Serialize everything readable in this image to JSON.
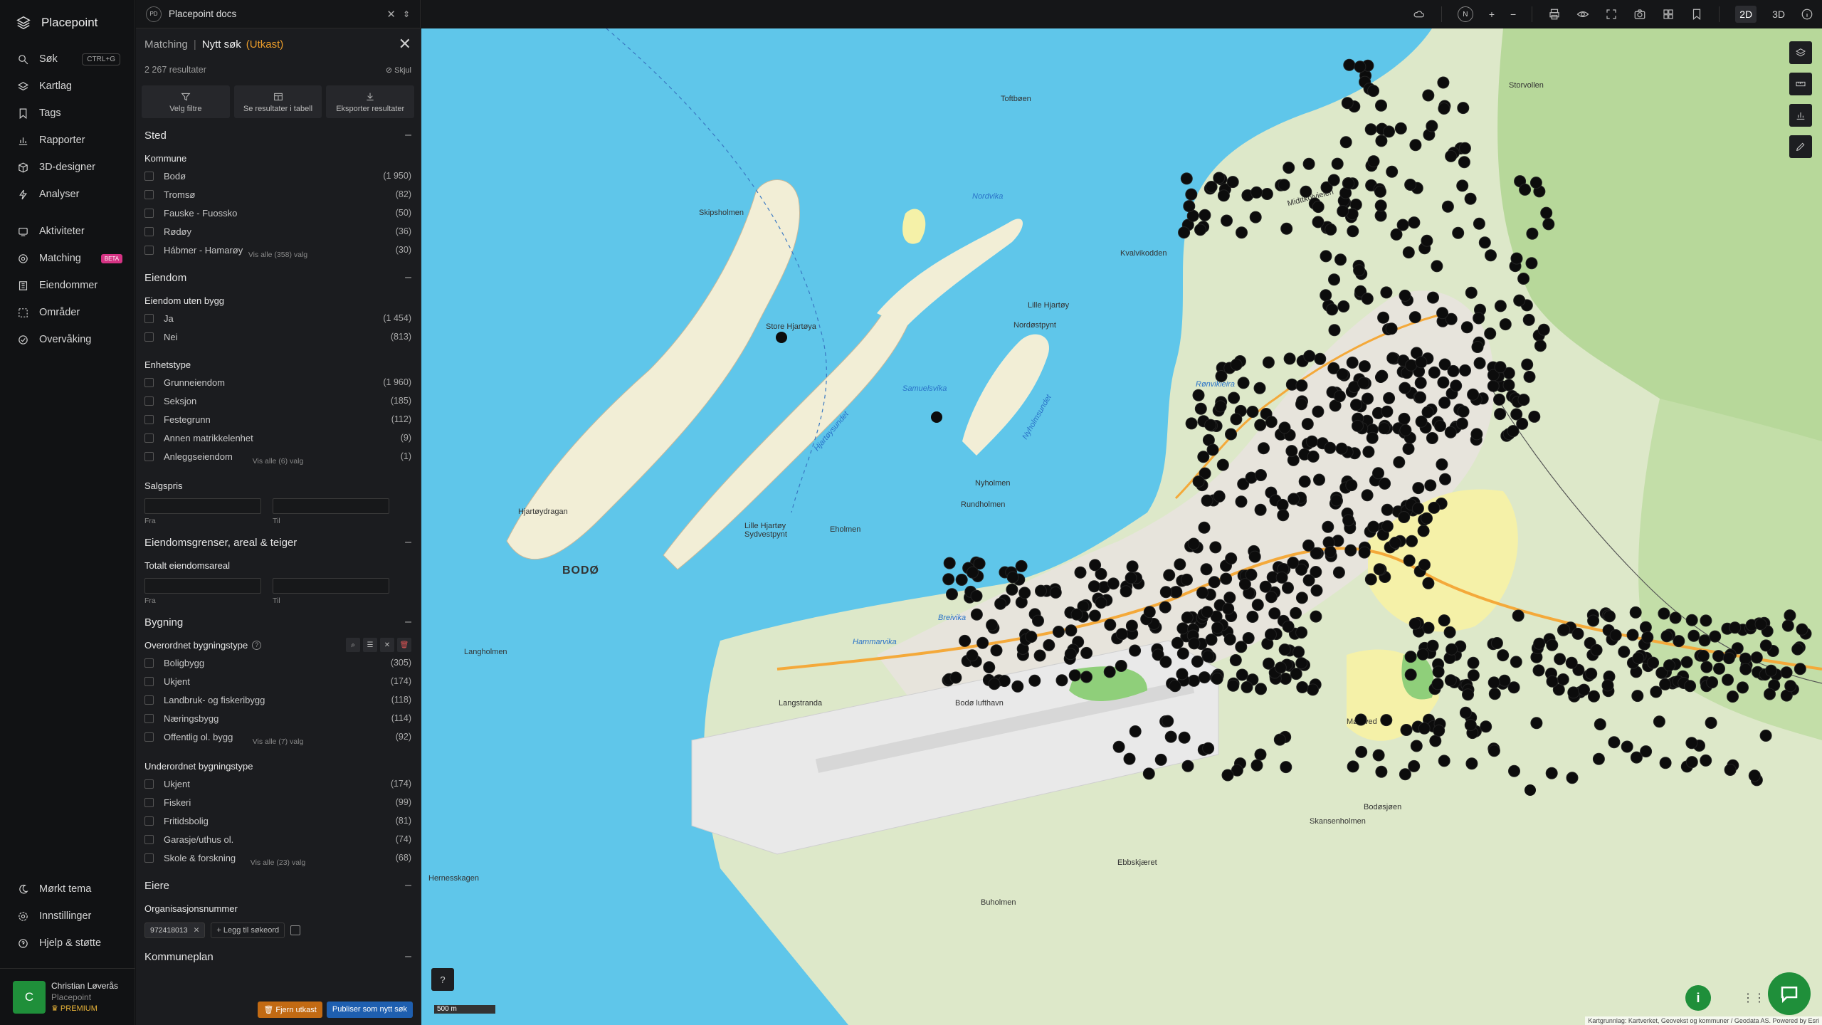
{
  "app": {
    "name": "Placepoint"
  },
  "nav": {
    "items": [
      {
        "label": "Søk",
        "icon": "search-icon",
        "shortcut": "CTRL+G"
      },
      {
        "label": "Kartlag",
        "icon": "layers-icon"
      },
      {
        "label": "Tags",
        "icon": "tag-icon"
      },
      {
        "label": "Rapporter",
        "icon": "report-icon"
      },
      {
        "label": "3D-designer",
        "icon": "cube-icon"
      },
      {
        "label": "Analyser",
        "icon": "bolt-icon"
      }
    ],
    "items2": [
      {
        "label": "Aktiviteter",
        "icon": "activity-icon"
      },
      {
        "label": "Matching",
        "icon": "match-icon",
        "badge": "BETA"
      },
      {
        "label": "Eiendommer",
        "icon": "building-icon"
      },
      {
        "label": "Områder",
        "icon": "area-icon"
      },
      {
        "label": "Overvåking",
        "icon": "monitor-icon"
      }
    ],
    "bottom": [
      {
        "label": "Mørkt tema",
        "icon": "moon-icon"
      },
      {
        "label": "Innstillinger",
        "icon": "gear-icon"
      },
      {
        "label": "Hjelp & støtte",
        "icon": "help-icon"
      }
    ],
    "user": {
      "initial": "C",
      "name": "Christian Løverås",
      "org": "Placepoint",
      "plan": "PREMIUM"
    }
  },
  "docbar": {
    "badge": "PD",
    "title": "Placepoint docs"
  },
  "panel": {
    "crumb": "Matching",
    "current": "Nytt søk",
    "draft": "(Utkast)",
    "results": "2 267 resultater",
    "hide": "Skjul",
    "actions": [
      "Velg filtre",
      "Se resultater i tabell",
      "Eksporter resultater"
    ],
    "sted": {
      "title": "Sted",
      "kommune_label": "Kommune",
      "kommune": [
        {
          "name": "Bodø",
          "count": "(1 950)"
        },
        {
          "name": "Tromsø",
          "count": "(82)"
        },
        {
          "name": "Fauske - Fuossko",
          "count": "(50)"
        },
        {
          "name": "Rødøy",
          "count": "(36)"
        },
        {
          "name": "Hábmer - Hamarøy",
          "count": "(30)"
        }
      ],
      "more": "Vis alle (358) valg"
    },
    "eiendom": {
      "title": "Eiendom",
      "uten_bygg_label": "Eiendom uten bygg",
      "uten_bygg": [
        {
          "name": "Ja",
          "count": "(1 454)"
        },
        {
          "name": "Nei",
          "count": "(813)"
        }
      ],
      "enhetstype_label": "Enhetstype",
      "enhetstype": [
        {
          "name": "Grunneiendom",
          "count": "(1 960)"
        },
        {
          "name": "Seksjon",
          "count": "(185)"
        },
        {
          "name": "Festegrunn",
          "count": "(112)"
        },
        {
          "name": "Annen matrikkelenhet",
          "count": "(9)"
        },
        {
          "name": "Anleggseiendom",
          "count": "(1)"
        }
      ],
      "more": "Vis alle (6) valg",
      "salgspris_label": "Salgspris",
      "from": "Fra",
      "to": "Til"
    },
    "grenser": {
      "title": "Eiendomsgrenser, areal & teiger",
      "areal_label": "Totalt eiendomsareal",
      "from": "Fra",
      "to": "Til"
    },
    "bygning": {
      "title": "Bygning",
      "overordnet_label": "Overordnet bygningstype",
      "overordnet": [
        {
          "name": "Boligbygg",
          "count": "(305)"
        },
        {
          "name": "Ukjent",
          "count": "(174)"
        },
        {
          "name": "Landbruk- og fiskeribygg",
          "count": "(118)"
        },
        {
          "name": "Næringsbygg",
          "count": "(114)"
        },
        {
          "name": "Offentlig ol. bygg",
          "count": "(92)"
        }
      ],
      "overordnet_more": "Vis alle (7) valg",
      "underordnet_label": "Underordnet bygningstype",
      "underordnet": [
        {
          "name": "Ukjent",
          "count": "(174)"
        },
        {
          "name": "Fiskeri",
          "count": "(99)"
        },
        {
          "name": "Fritidsbolig",
          "count": "(81)"
        },
        {
          "name": "Garasje/uthus ol.",
          "count": "(74)"
        },
        {
          "name": "Skole & forskning",
          "count": "(68)"
        }
      ],
      "underordnet_more": "Vis alle (23) valg"
    },
    "eiere": {
      "title": "Eiere",
      "orgnr_label": "Organisasjonsnummer",
      "chip": "972418013",
      "add": "Legg til søkeord"
    },
    "kommuneplan": {
      "title": "Kommuneplan"
    },
    "buttons": {
      "remove": "Fjern utkast",
      "publish": "Publiser som nytt søk"
    }
  },
  "topbar": {
    "dim2d": "2D",
    "dim3d": "3D",
    "compass": "N"
  },
  "map": {
    "scale": "500 m",
    "attribution": "Kartgrunnlag: Kartverket, Geovekst og kommuner / Geodata AS. Powered by Esri",
    "labels": [
      {
        "text": "BODØ",
        "kind": "city"
      },
      {
        "text": "Skipsholmen",
        "kind": "land"
      },
      {
        "text": "Toftbøen",
        "kind": "land"
      },
      {
        "text": "Storvollen",
        "kind": "land"
      },
      {
        "text": "Nordvika",
        "kind": "water"
      },
      {
        "text": "Lille Hjartøy",
        "kind": "land"
      },
      {
        "text": "Nordøstpynt",
        "kind": "land"
      },
      {
        "text": "Hjartøysundet",
        "kind": "water"
      },
      {
        "text": "Samuelsvika",
        "kind": "water"
      },
      {
        "text": "Store Hjartøya",
        "kind": "land"
      },
      {
        "text": "Hjartøydragan",
        "kind": "land"
      },
      {
        "text": "Lille Hjartøy Sydvestpynt",
        "kind": "land"
      },
      {
        "text": "Eholmen",
        "kind": "land"
      },
      {
        "text": "Nyholmsundet",
        "kind": "water"
      },
      {
        "text": "Nyholmen",
        "kind": "land"
      },
      {
        "text": "Rundholmen",
        "kind": "land"
      },
      {
        "text": "Langholmen",
        "kind": "land"
      },
      {
        "text": "Hammarvika",
        "kind": "water"
      },
      {
        "text": "Langstranda",
        "kind": "land"
      },
      {
        "text": "Bodø lufthavn",
        "kind": "land"
      },
      {
        "text": "Skansenholmen",
        "kind": "land"
      },
      {
        "text": "Ebbskjæret",
        "kind": "land"
      },
      {
        "text": "Buholmen",
        "kind": "land"
      },
      {
        "text": "Hernesskagen",
        "kind": "land"
      },
      {
        "text": "Midttkolvieien",
        "kind": "land"
      },
      {
        "text": "Kvalvikodden",
        "kind": "land"
      },
      {
        "text": "Rønvikleira",
        "kind": "water"
      },
      {
        "text": "Breivika",
        "kind": "water"
      },
      {
        "text": "Mørkved",
        "kind": "land"
      },
      {
        "text": "Bodøsjøen",
        "kind": "land"
      }
    ]
  }
}
